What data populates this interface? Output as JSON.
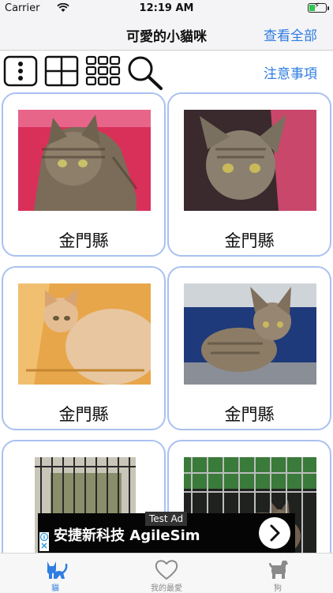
{
  "status_bar": {
    "carrier": "Carrier",
    "time": "12:19 AM"
  },
  "nav": {
    "title": "可愛的小貓咪",
    "view_all": "查看全部"
  },
  "toolbar": {
    "notes": "注意事項"
  },
  "cards": [
    {
      "location": "金門縣",
      "photo": "tabby cat in pink carrier"
    },
    {
      "location": "金門縣",
      "photo": "tabby cat in pink carrier"
    },
    {
      "location": "金門縣",
      "photo": "orange cat in yellow carrier"
    },
    {
      "location": "金門縣",
      "photo": "tabby cat in blue carrier"
    },
    {
      "location": "",
      "photo": "tabby cat in metal cage"
    },
    {
      "location": "",
      "photo": "tabby cat in metal cage"
    }
  ],
  "ad": {
    "tag": "Test Ad",
    "text": "安捷新科技 AgileSim"
  },
  "tabs": [
    {
      "label": "貓",
      "icon": "cat-icon",
      "active": true
    },
    {
      "label": "我的最愛",
      "icon": "heart-icon",
      "active": false
    },
    {
      "label": "狗",
      "icon": "dog-icon",
      "active": false
    }
  ],
  "colors": {
    "accent": "#2f7de1",
    "card_border": "#a9c1f0"
  }
}
